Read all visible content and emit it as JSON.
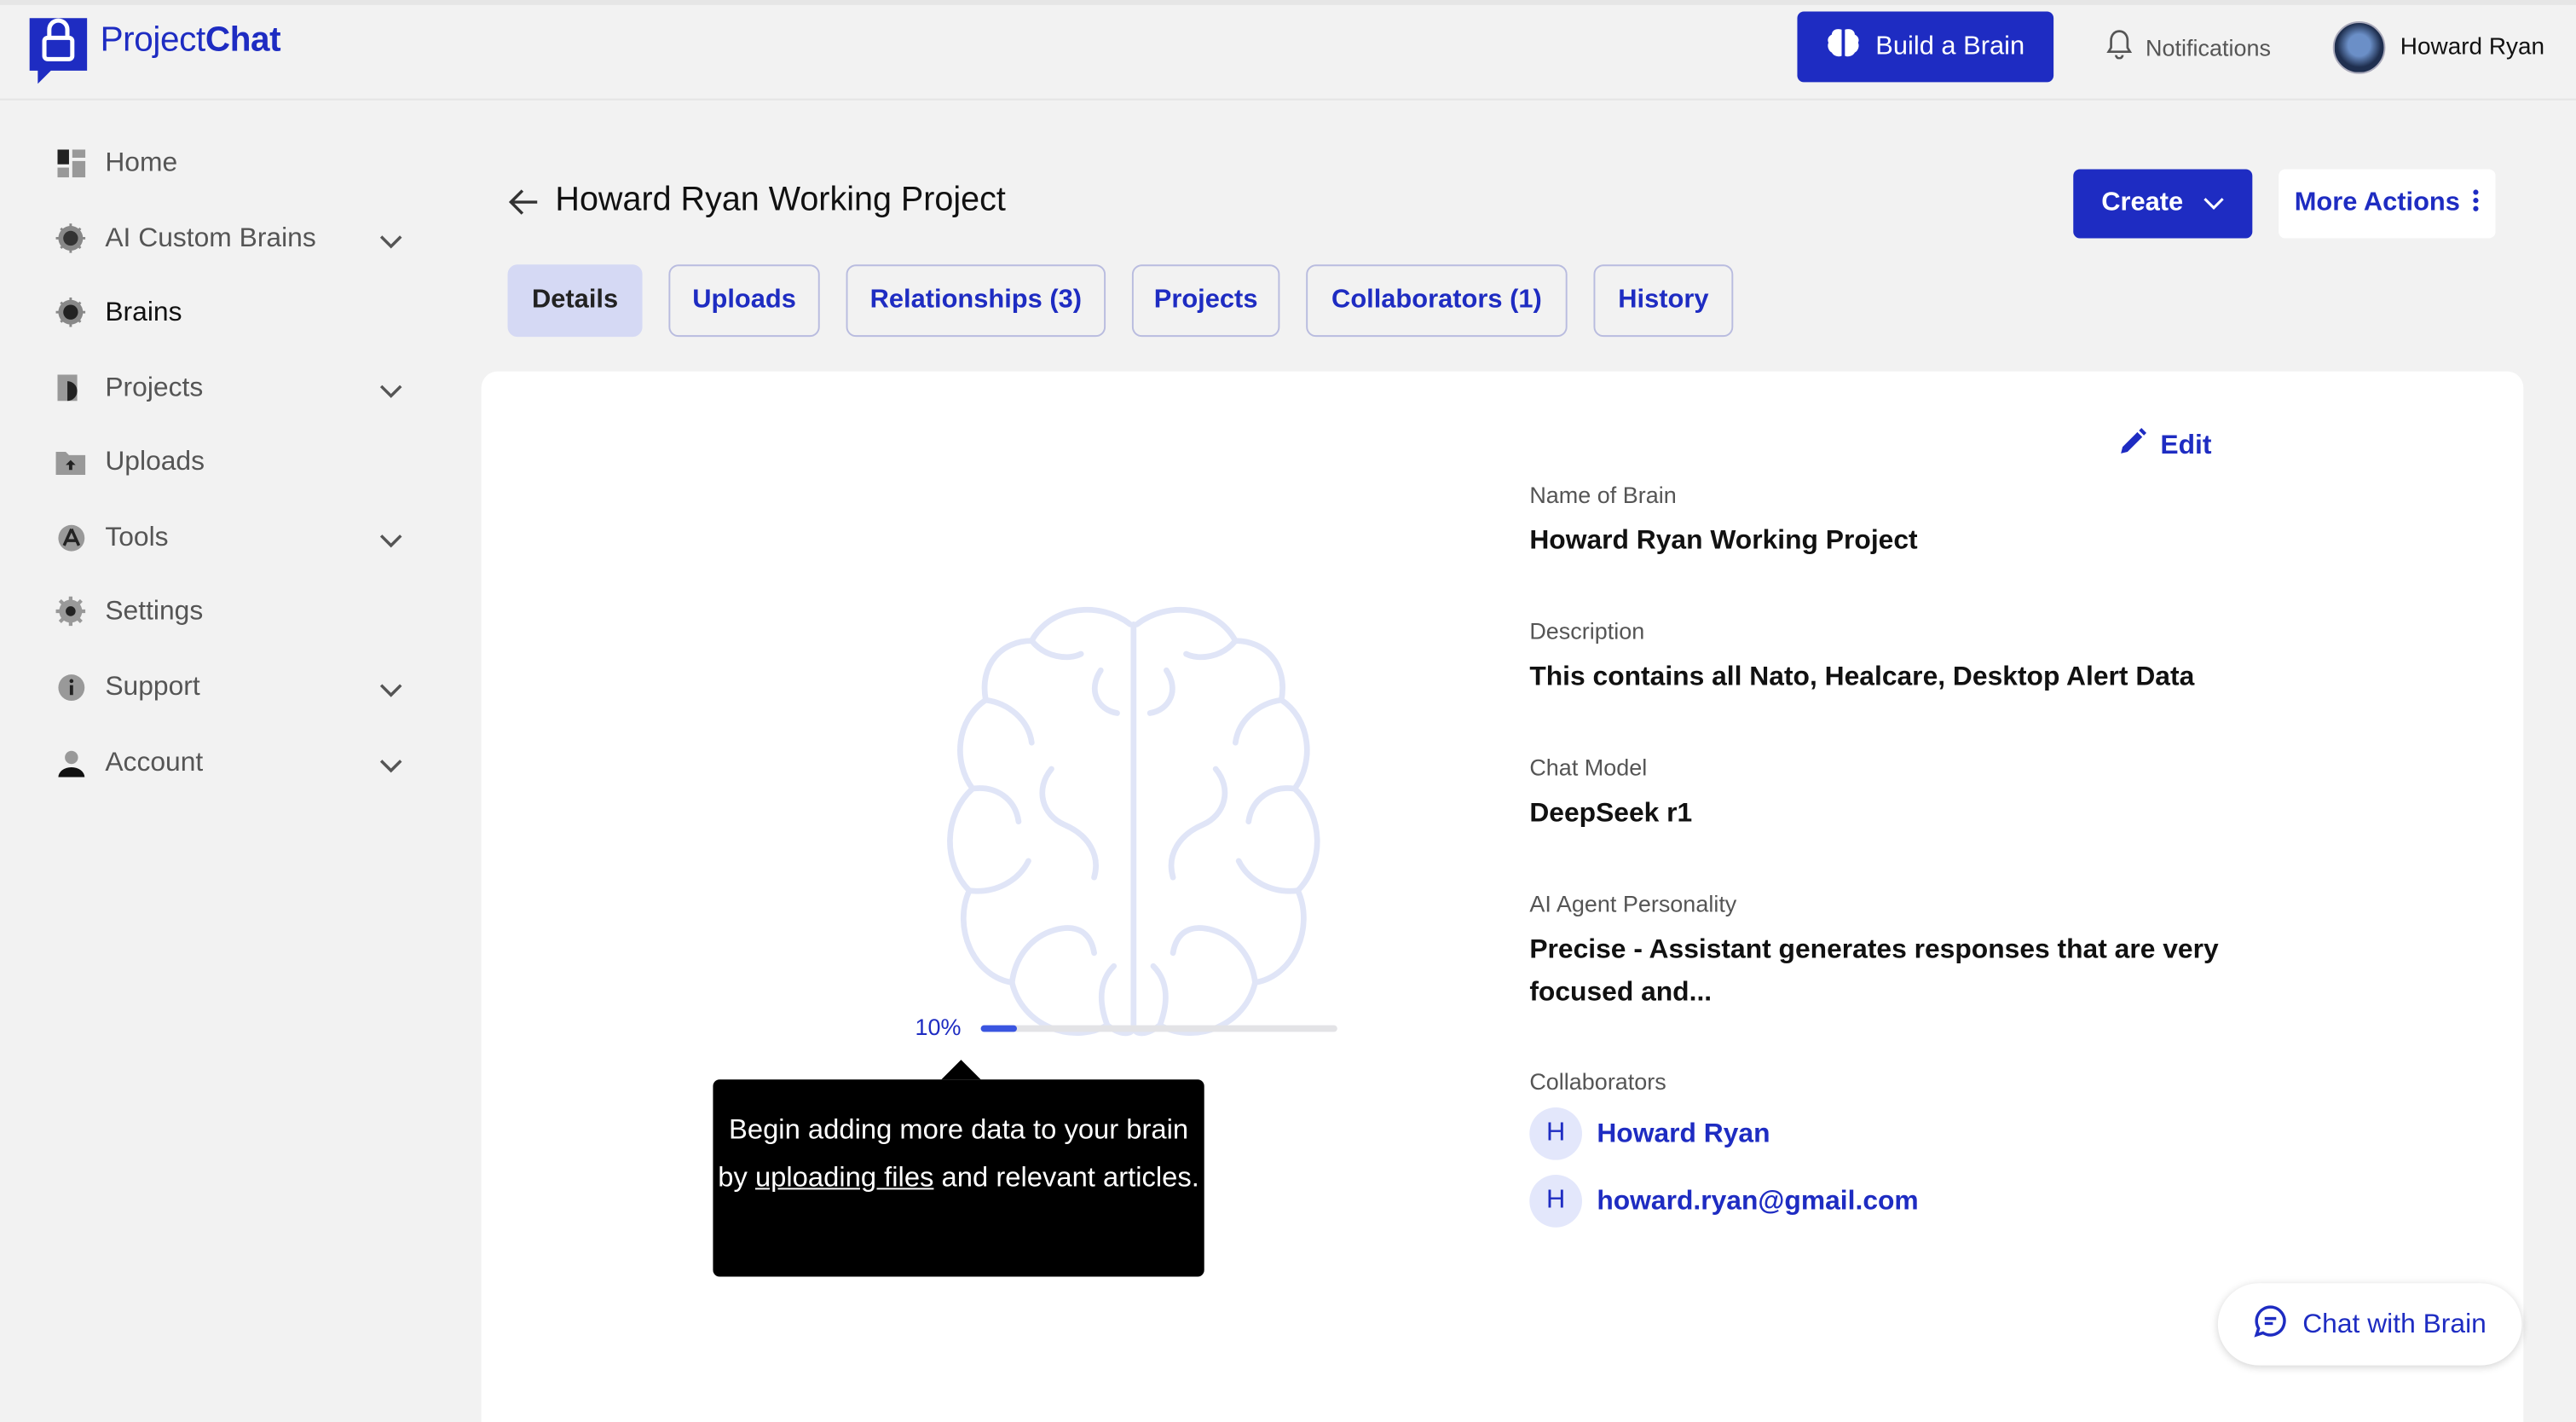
{
  "app": {
    "logo_text_regular": "Project",
    "logo_text_bold": "Chat",
    "brand_color": "#1e2cc2"
  },
  "topbar": {
    "build_brain_label": "Build a Brain",
    "notifications_label": "Notifications",
    "user_name": "Howard Ryan"
  },
  "sidebar": {
    "items": [
      {
        "label": "Home",
        "icon": "dashboard-icon",
        "has_chevron": false
      },
      {
        "label": "AI Custom Brains",
        "icon": "chip-icon",
        "has_chevron": true
      },
      {
        "label": "Brains",
        "icon": "chip-icon",
        "has_chevron": false,
        "active": true
      },
      {
        "label": "Projects",
        "icon": "projects-icon",
        "has_chevron": true
      },
      {
        "label": "Uploads",
        "icon": "folder-upload-icon",
        "has_chevron": false
      },
      {
        "label": "Tools",
        "icon": "tools-icon",
        "has_chevron": true
      },
      {
        "label": "Settings",
        "icon": "gear-icon",
        "has_chevron": false
      },
      {
        "label": "Support",
        "icon": "info-icon",
        "has_chevron": true
      },
      {
        "label": "Account",
        "icon": "user-icon",
        "has_chevron": true
      }
    ]
  },
  "header": {
    "title": "Howard Ryan Working Project",
    "create_label": "Create",
    "more_actions_label": "More Actions"
  },
  "tabs": [
    {
      "label": "Details",
      "active": true
    },
    {
      "label": "Uploads"
    },
    {
      "label": "Relationships (3)"
    },
    {
      "label": "Projects"
    },
    {
      "label": "Collaborators (1)"
    },
    {
      "label": "History"
    }
  ],
  "progress": {
    "label": "10%",
    "value": 0.1
  },
  "tooltip": {
    "text_before": "Begin adding more data to your brain by ",
    "link_text": "uploading files",
    "text_after": " and relevant articles."
  },
  "details": {
    "edit_label": "Edit",
    "name_label": "Name of Brain",
    "name_value": "Howard Ryan Working Project",
    "description_label": "Description",
    "description_value": "This contains all Nato, Healcare, Desktop Alert Data",
    "chat_model_label": "Chat Model",
    "chat_model_value": "DeepSeek r1",
    "personality_label": "AI Agent Personality",
    "personality_value": "Precise - Assistant generates responses that are very focused and...",
    "collaborators_label": "Collaborators",
    "collaborators": [
      {
        "initial": "H",
        "name": "Howard Ryan"
      },
      {
        "initial": "H",
        "name": "howard.ryan@gmail.com"
      }
    ]
  },
  "chat_button_label": "Chat with Brain"
}
